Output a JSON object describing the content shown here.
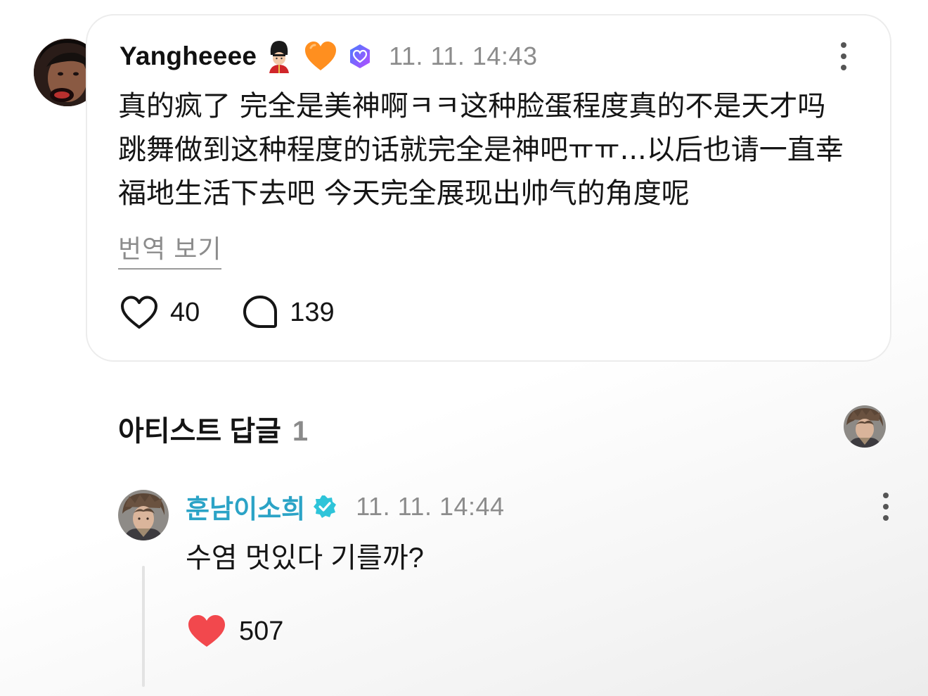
{
  "fan_comment": {
    "username": "Yangheeee",
    "emojis": [
      "guardsman-emoji",
      "orange-heart-emoji"
    ],
    "badge": "verified-fan-badge",
    "timestamp": "11. 11. 14:43",
    "text": "真的疯了 完全是美神啊ㅋㅋ这种脸蛋程度真的不是天才吗\n跳舞做到这种程度的话就完全是神吧ㅠㅠ...以后也请一直幸\n福地生活下去吧 今天完全展现出帅气的角度呢",
    "translate_label": "번역 보기",
    "like_count": "40",
    "reply_count": "139"
  },
  "artist_section": {
    "title": "아티스트 답글",
    "count": "1"
  },
  "artist_reply": {
    "username": "훈남이소희",
    "badge": "verified-artist-badge",
    "timestamp": "11. 11. 14:44",
    "text": "수염 멋있다 기를까?",
    "like_count": "507",
    "liked": true
  },
  "colors": {
    "artist_name": "#2ba3c6",
    "liked_heart": "#f2484d",
    "timestamp": "#8c8c8c"
  }
}
